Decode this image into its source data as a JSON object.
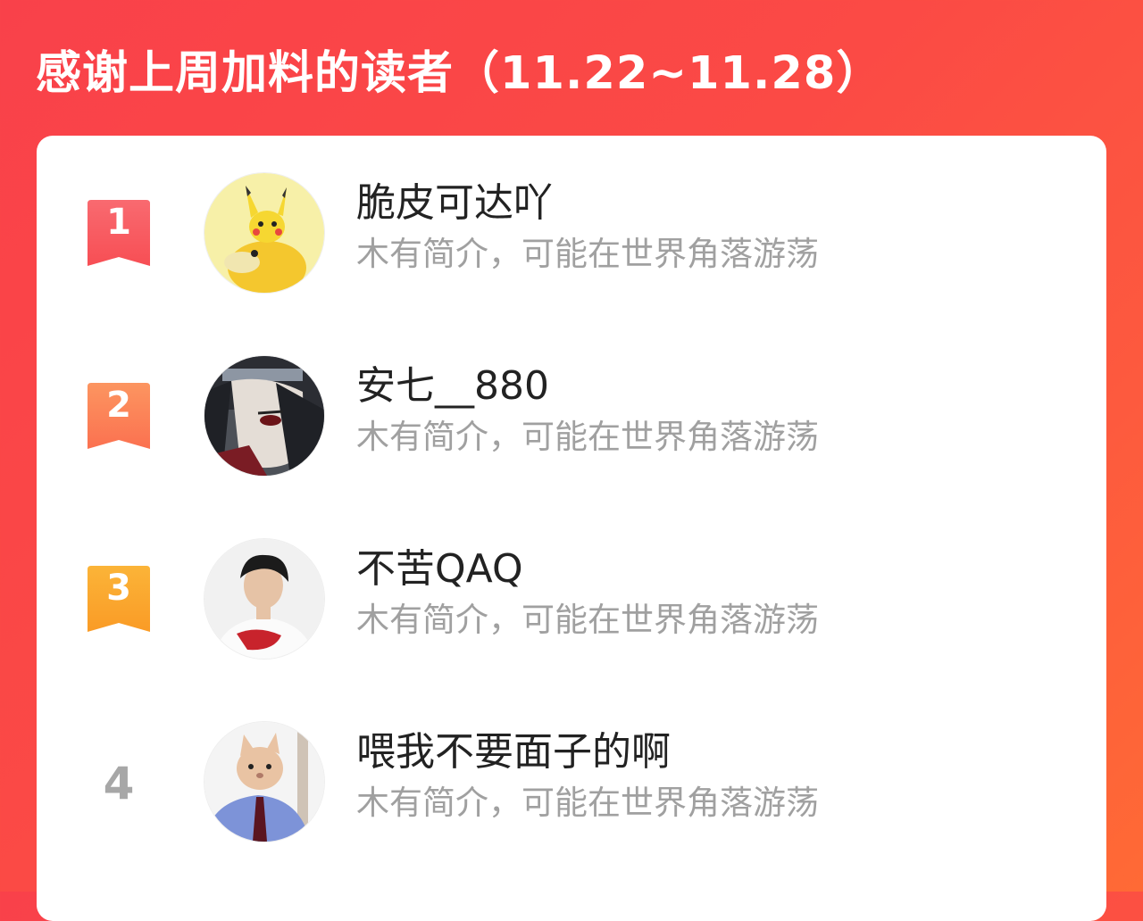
{
  "header": {
    "title": "感谢上周加料的读者（11.22~11.28）"
  },
  "colors": {
    "background_start": "#f9414a",
    "background_end": "#ff6a35",
    "rank1": "#f9575c",
    "rank2": "#fb7c52",
    "rank3": "#fba52a",
    "rank_plain": "#a7a7a7",
    "name_text": "#222222",
    "bio_text": "#a0a0a0"
  },
  "readers": [
    {
      "rank": "1",
      "name": "脆皮可达吖",
      "bio": "木有简介，可能在世界角落游荡",
      "avatar_icon": "pikachu-psyduck-avatar-icon"
    },
    {
      "rank": "2",
      "name": "安七__880",
      "bio": "木有简介，可能在世界角落游荡",
      "avatar_icon": "anime-ninja-avatar-icon"
    },
    {
      "rank": "3",
      "name": "不苦QAQ",
      "bio": "木有简介，可能在世界角落游荡",
      "avatar_icon": "boy-portrait-avatar-icon"
    },
    {
      "rank": "4",
      "name": "喂我不要面子的啊",
      "bio": "木有简介，可能在世界角落游荡",
      "avatar_icon": "cat-mask-avatar-icon"
    }
  ]
}
